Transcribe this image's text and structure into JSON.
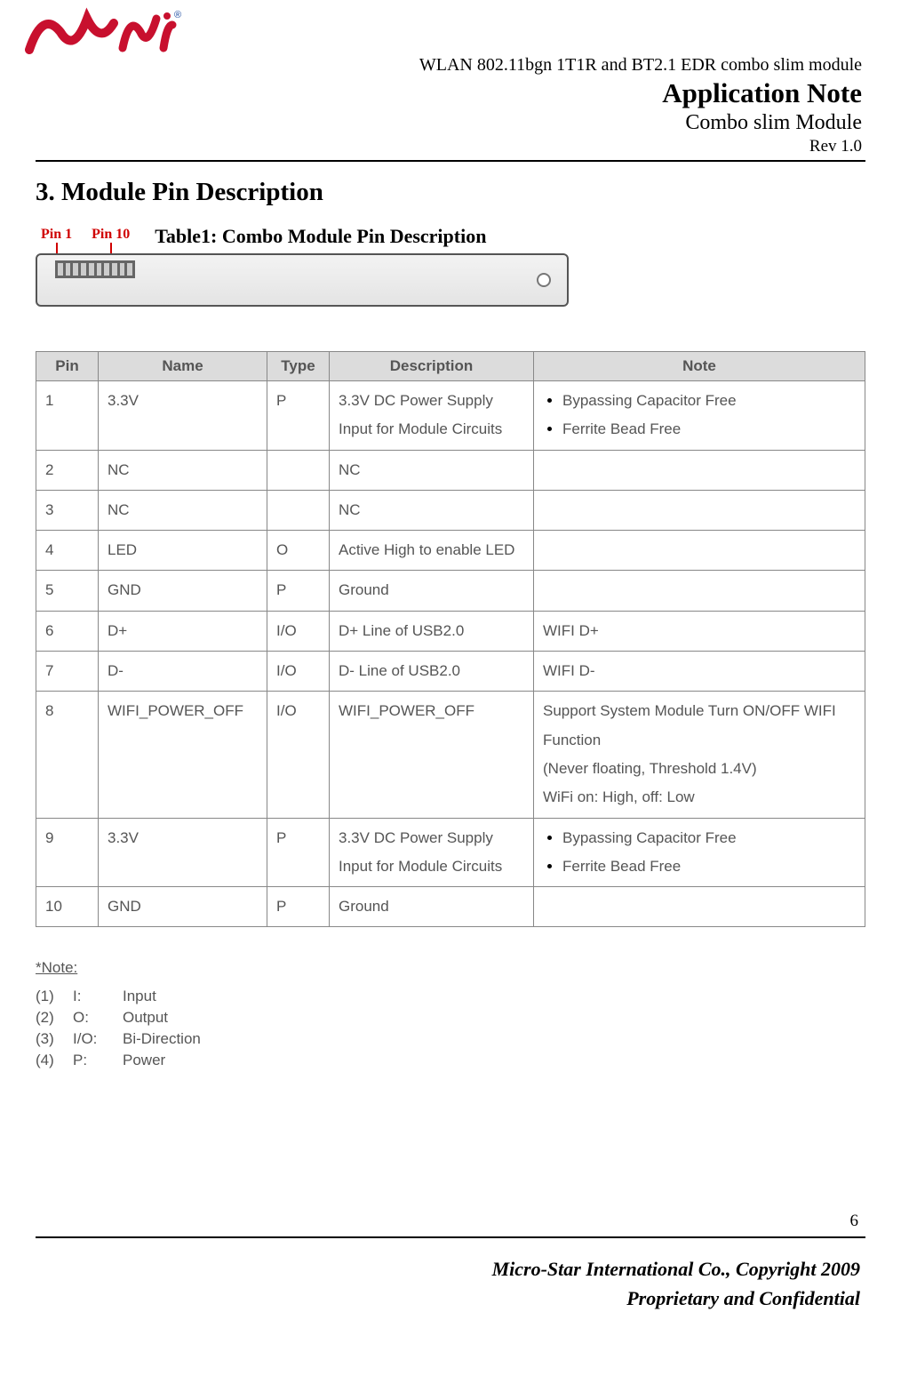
{
  "header": {
    "line1": "WLAN 802.11bgn 1T1R and BT2.1 EDR combo slim module",
    "line2": "Application Note",
    "line3": "Combo slim Module",
    "line4": "Rev 1.0"
  },
  "section_title": "3.   Module Pin Description",
  "pin_arrow_1": "Pin 1",
  "pin_arrow_10": "Pin 10",
  "table_caption": "Table1: Combo Module Pin Description",
  "columns": {
    "pin": "Pin",
    "name": "Name",
    "type": "Type",
    "desc": "Description",
    "note": "Note"
  },
  "rows": [
    {
      "pin": "1",
      "name": "3.3V",
      "type": "P",
      "desc": "3.3V DC Power Supply Input for Module Circuits",
      "note_bullets": [
        "Bypassing Capacitor Free",
        "Ferrite Bead Free"
      ]
    },
    {
      "pin": "2",
      "name": "NC",
      "type": "",
      "desc": "NC",
      "note_plain": ""
    },
    {
      "pin": "3",
      "name": "NC",
      "type": "",
      "desc": "NC",
      "note_plain": ""
    },
    {
      "pin": "4",
      "name": "LED",
      "type": "O",
      "desc": "Active High to enable LED",
      "note_plain": ""
    },
    {
      "pin": "5",
      "name": "GND",
      "type": "P",
      "desc": "Ground",
      "note_plain": ""
    },
    {
      "pin": "6",
      "name": "D+",
      "type": "I/O",
      "desc": "D+ Line of USB2.0",
      "note_plain": "WIFI D+"
    },
    {
      "pin": "7",
      "name": "D-",
      "type": "I/O",
      "desc": "D- Line of USB2.0",
      "note_plain": "WIFI D-"
    },
    {
      "pin": "8",
      "name": "WIFI_POWER_OFF",
      "type": "I/O",
      "desc": "WIFI_POWER_OFF",
      "note_plain": "Support System Module Turn ON/OFF WIFI Function\n(Never floating, Threshold 1.4V)\nWiFi on: High, off: Low"
    },
    {
      "pin": "9",
      "name": "3.3V",
      "type": "P",
      "desc": "3.3V DC Power Supply Input for Module Circuits",
      "note_bullets": [
        "Bypassing Capacitor Free",
        "Ferrite Bead Free"
      ]
    },
    {
      "pin": "10",
      "name": "GND",
      "type": "P",
      "desc": "Ground",
      "note_plain": ""
    }
  ],
  "note_title": "*Note:  ",
  "legend": [
    {
      "ix": "(1)",
      "key": "I:",
      "val": "Input"
    },
    {
      "ix": "(2)",
      "key": "O:",
      "val": "Output"
    },
    {
      "ix": "(3)",
      "key": "I/O:",
      "val": "Bi-Direction"
    },
    {
      "ix": "(4)",
      "key": "P:",
      "val": "Power"
    }
  ],
  "page_number": "6",
  "footer": {
    "l1": "Micro-Star International Co., Copyright 2009",
    "l2": "Proprietary and Confidential"
  }
}
